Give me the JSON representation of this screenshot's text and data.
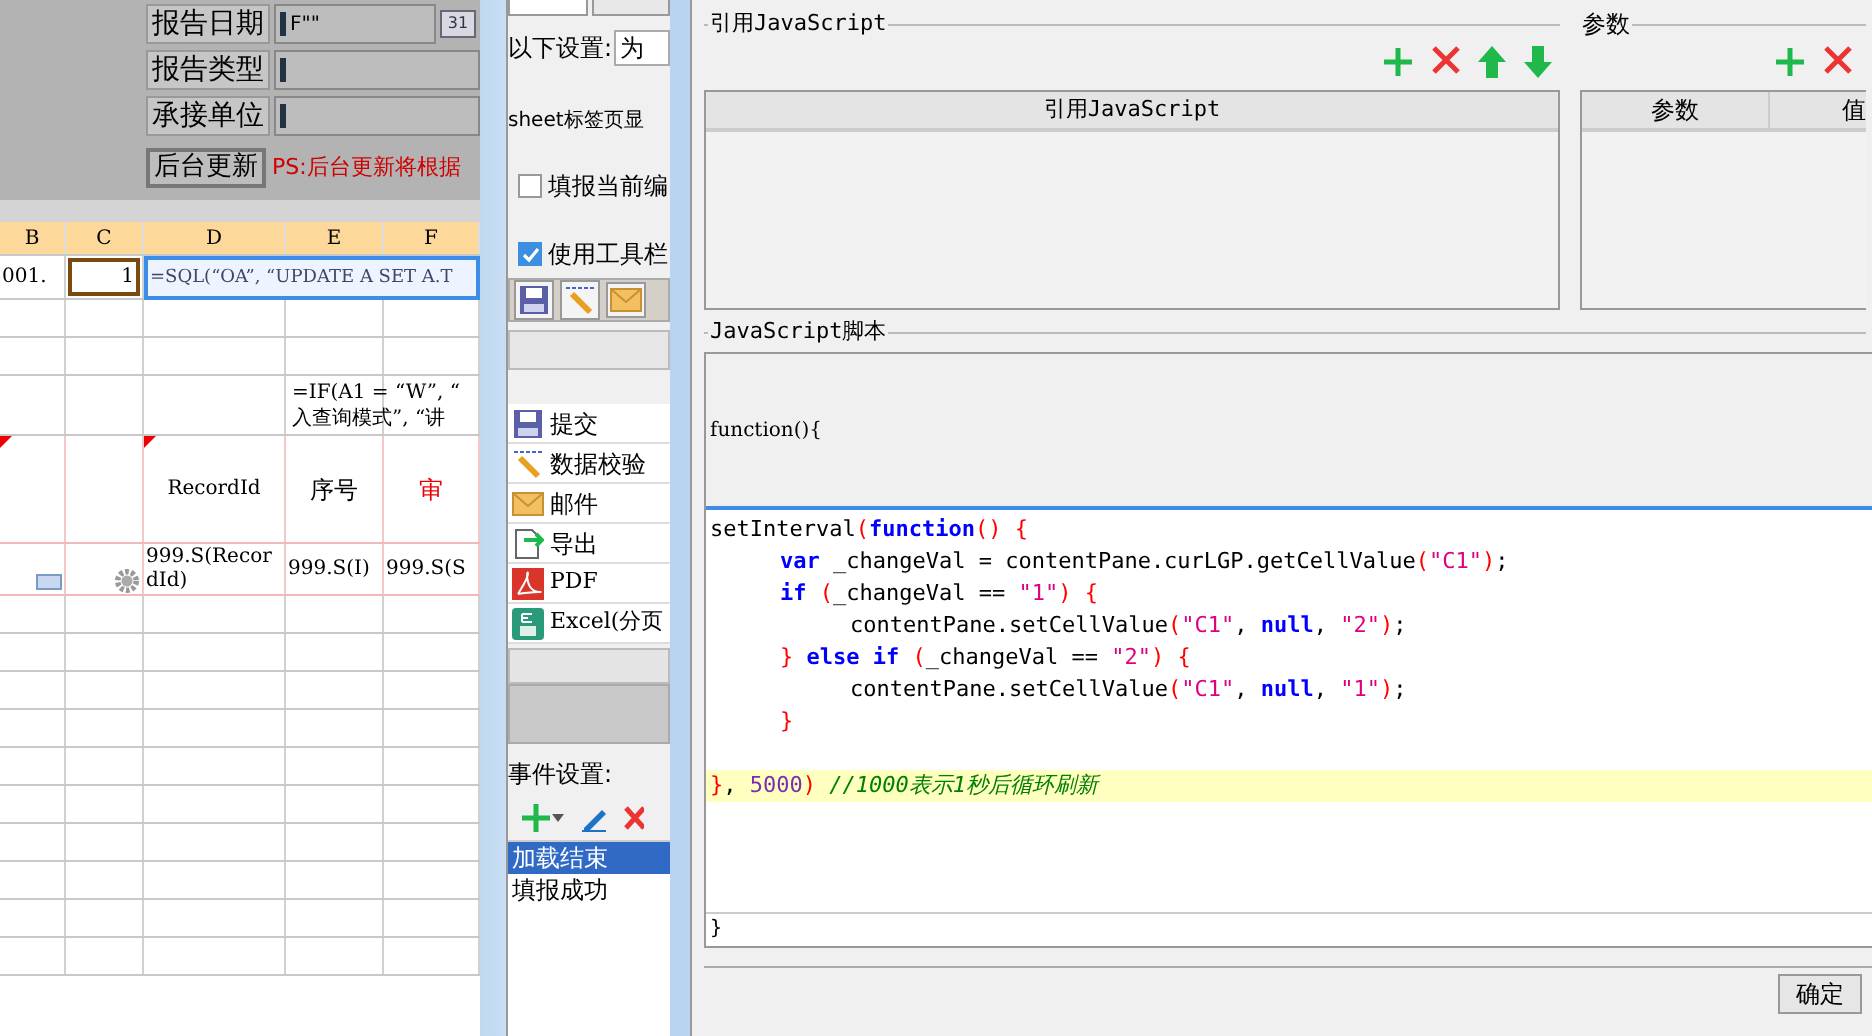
{
  "report_form": {
    "fields": [
      {
        "label": "报告日期",
        "value": "F\"\"",
        "kind": "date"
      },
      {
        "label": "报告类型",
        "kind": "text"
      },
      {
        "label": "承接单位",
        "kind": "text"
      }
    ],
    "calendar_day": "31",
    "update_button": "后台更新",
    "note": "PS:后台更新将根据"
  },
  "sheet": {
    "columns": [
      "B",
      "C",
      "D",
      "E",
      "F"
    ],
    "formula": "=SQL(“OA”, “UPDATE A SET A.T",
    "rows": [
      {
        "kind": "data",
        "cells": [
          {
            "text": "001.",
            "selected": false
          },
          {
            "text": "1",
            "selected": true
          },
          {},
          {},
          {}
        ]
      },
      {
        "kind": "empty"
      },
      {
        "kind": "empty"
      },
      {
        "kind": "formula",
        "text": "=IF(A1 = “W”, “",
        "text_2": "入查询模式”, “讲"
      },
      {
        "kind": "header",
        "cells": [
          {},
          {},
          {
            "text": "RecordId"
          },
          {
            "text": "序号"
          },
          {
            "text": "审"
          }
        ]
      },
      {
        "kind": "record",
        "cells": [
          {},
          {},
          {
            "text": "999.S(RecordId)"
          },
          {
            "text": "999.S(I)"
          },
          {
            "text": "999.S(S"
          }
        ]
      },
      {
        "kind": "empty"
      },
      {
        "kind": "empty"
      },
      {
        "kind": "empty"
      },
      {
        "kind": "empty"
      },
      {
        "kind": "empty"
      },
      {
        "kind": "empty"
      },
      {
        "kind": "empty"
      },
      {
        "kind": "empty"
      },
      {
        "kind": "empty"
      },
      {
        "kind": "empty"
      }
    ]
  },
  "settings_dialog": {
    "setting_label": "以下设置:",
    "setting_value": "为",
    "sheet_label": "sheet标签页显",
    "checkboxes": [
      {
        "label": "填报当前编",
        "checked": false
      },
      {
        "label": "使用工具栏",
        "checked": true
      }
    ],
    "toolbar_items": [
      {
        "label": "提交",
        "kind": "save"
      },
      {
        "label": "数据校验",
        "kind": "check"
      },
      {
        "label": "邮件",
        "kind": "mail"
      },
      {
        "label": "导出",
        "kind": "export"
      },
      {
        "label": "PDF",
        "kind": "pdf"
      },
      {
        "label": "Excel(分页",
        "kind": "excel"
      }
    ],
    "events_label": "事件设置:",
    "events": [
      {
        "label": "加载结束",
        "selected": true
      },
      {
        "label": "填报成功",
        "selected": false
      }
    ]
  },
  "js_dialog": {
    "ref_group": "引用JavaScript",
    "ref_column": "引用JavaScript",
    "param_group": "参数",
    "param_columns": [
      "参数",
      "值"
    ],
    "script_group": "JavaScript脚本",
    "script_head": "function(){",
    "script_tail": "}",
    "code_lines": [
      {
        "kind": "code",
        "highlighted": false,
        "tokens": [
          {
            "text": "setInterval",
            "kind": "plain"
          },
          {
            "text": "(",
            "kind": "paren"
          },
          {
            "text": "function",
            "kind": "keyword"
          },
          {
            "text": "() {",
            "kind": "paren"
          }
        ],
        "children": [
          {
            "kind": "code",
            "tokens": [
              {
                "text": "var",
                "kind": "keyword"
              },
              {
                "text": " _changeVal = contentPane.curLGP.getCellValue",
                "kind": "plain"
              },
              {
                "text": "(",
                "kind": "paren"
              },
              {
                "text": "\"C1\"",
                "kind": "string"
              },
              {
                "text": ")",
                "kind": "paren"
              },
              {
                "text": ";",
                "kind": "plain"
              }
            ]
          },
          {
            "kind": "code",
            "tokens": [
              {
                "text": "if",
                "kind": "keyword"
              },
              {
                "text": " (",
                "kind": "paren"
              },
              {
                "text": "_changeVal == ",
                "kind": "plain"
              },
              {
                "text": "\"1\"",
                "kind": "string"
              },
              {
                "text": ") {",
                "kind": "paren"
              }
            ],
            "children": [
              {
                "kind": "code",
                "tokens": [
                  {
                    "text": "contentPane.setCellValue",
                    "kind": "plain"
                  },
                  {
                    "text": "(",
                    "kind": "paren"
                  },
                  {
                    "text": "\"C1\"",
                    "kind": "string"
                  },
                  {
                    "text": ", ",
                    "kind": "plain"
                  },
                  {
                    "text": "null",
                    "kind": "keyword"
                  },
                  {
                    "text": ", ",
                    "kind": "plain"
                  },
                  {
                    "text": "\"2\"",
                    "kind": "string"
                  },
                  {
                    "text": ")",
                    "kind": "paren"
                  },
                  {
                    "text": ";",
                    "kind": "plain"
                  }
                ]
              }
            ]
          },
          {
            "kind": "code",
            "tokens": [
              {
                "text": "} ",
                "kind": "paren"
              },
              {
                "text": "else if",
                "kind": "keyword"
              },
              {
                "text": " (",
                "kind": "paren"
              },
              {
                "text": "_changeVal == ",
                "kind": "plain"
              },
              {
                "text": "\"2\"",
                "kind": "string"
              },
              {
                "text": ") {",
                "kind": "paren"
              }
            ],
            "children": [
              {
                "kind": "code",
                "tokens": [
                  {
                    "text": "contentPane.setCellValue",
                    "kind": "plain"
                  },
                  {
                    "text": "(",
                    "kind": "paren"
                  },
                  {
                    "text": "\"C1\"",
                    "kind": "string"
                  },
                  {
                    "text": ", ",
                    "kind": "plain"
                  },
                  {
                    "text": "null",
                    "kind": "keyword"
                  },
                  {
                    "text": ", ",
                    "kind": "plain"
                  },
                  {
                    "text": "\"1\"",
                    "kind": "string"
                  },
                  {
                    "text": ")",
                    "kind": "paren"
                  },
                  {
                    "text": ";",
                    "kind": "plain"
                  }
                ]
              }
            ]
          },
          {
            "kind": "code",
            "tokens": [
              {
                "text": "}",
                "kind": "paren"
              }
            ]
          }
        ]
      },
      {
        "kind": "blank"
      },
      {
        "kind": "code",
        "highlighted": true,
        "tokens": [
          {
            "text": "}",
            "kind": "paren"
          },
          {
            "text": ", ",
            "kind": "plain"
          },
          {
            "text": "5000",
            "kind": "number"
          },
          {
            "text": ") ",
            "kind": "paren"
          },
          {
            "text": "//1000表示1秒后循环刷新",
            "kind": "comment"
          }
        ]
      }
    ],
    "ok_button": "确定"
  }
}
